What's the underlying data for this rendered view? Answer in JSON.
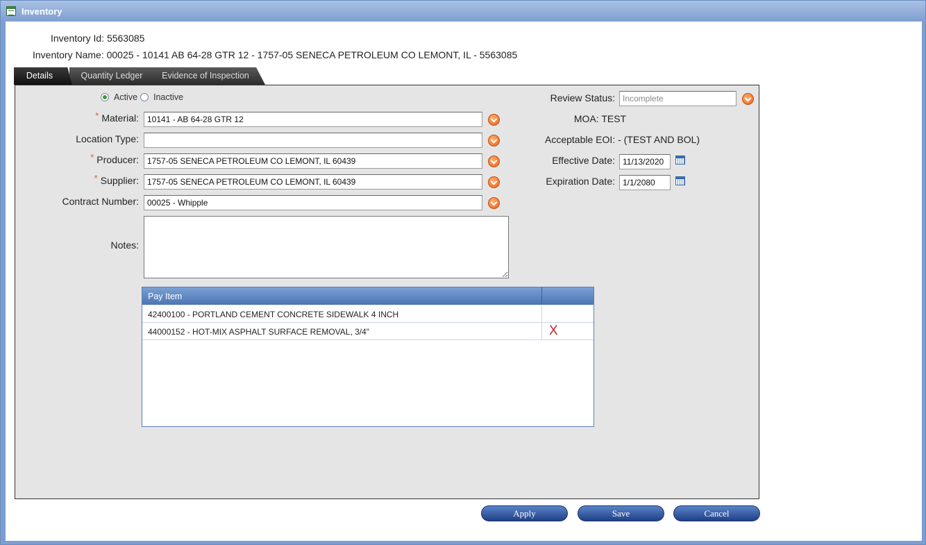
{
  "window": {
    "title": "Inventory",
    "icon": "form-icon"
  },
  "header": {
    "inventory_id_label": "Inventory Id:",
    "inventory_id": "5563085",
    "inventory_name_label": "Inventory Name:",
    "inventory_name": "00025 - 10141 AB 64-28 GTR 12 - 1757-05 SENECA PETROLEUM CO LEMONT, IL - 5563085"
  },
  "tabs": [
    {
      "label": "Details",
      "active": true
    },
    {
      "label": "Quantity Ledger",
      "active": false
    },
    {
      "label": "Evidence of Inspection",
      "active": false
    }
  ],
  "status_radio": {
    "active_label": "Active",
    "inactive_label": "Inactive",
    "selected": "Active"
  },
  "form": {
    "material_label": "Material:",
    "material_value": "10141 - AB 64-28 GTR 12",
    "location_type_label": "Location Type:",
    "location_type_value": "",
    "producer_label": "Producer:",
    "producer_value": "1757-05 SENECA PETROLEUM CO LEMONT, IL 60439",
    "supplier_label": "Supplier:",
    "supplier_value": "1757-05 SENECA PETROLEUM CO LEMONT, IL 60439",
    "contract_label": "Contract Number:",
    "contract_value": "00025 - Whipple",
    "notes_label": "Notes:",
    "notes_value": "",
    "required_marker": "*"
  },
  "right": {
    "review_status_label": "Review Status:",
    "review_status_placeholder": "Incomplete",
    "moa_label": "MOA:",
    "moa_value": "TEST",
    "eoi_label": "Acceptable EOI:",
    "eoi_value": "- (TEST AND BOL)",
    "effective_label": "Effective Date:",
    "effective_value": "11/13/2020",
    "expiration_label": "Expiration Date:",
    "expiration_value": "1/1/2080"
  },
  "pay_items": {
    "header": "Pay Item",
    "rows": [
      {
        "text": "42400100 - PORTLAND CEMENT CONCRETE SIDEWALK 4 INCH",
        "delete": ""
      },
      {
        "text": "44000152 - HOT-MIX ASPHALT SURFACE REMOVAL, 3/4\"",
        "delete": "X"
      }
    ]
  },
  "buttons": {
    "apply": "Apply",
    "save": "Save",
    "cancel": "Cancel"
  },
  "colors": {
    "accent": "#e8621a",
    "tab_dark": "#2c2c2c",
    "button_blue": "#1f3f86",
    "delete_red": "#c0262c"
  }
}
